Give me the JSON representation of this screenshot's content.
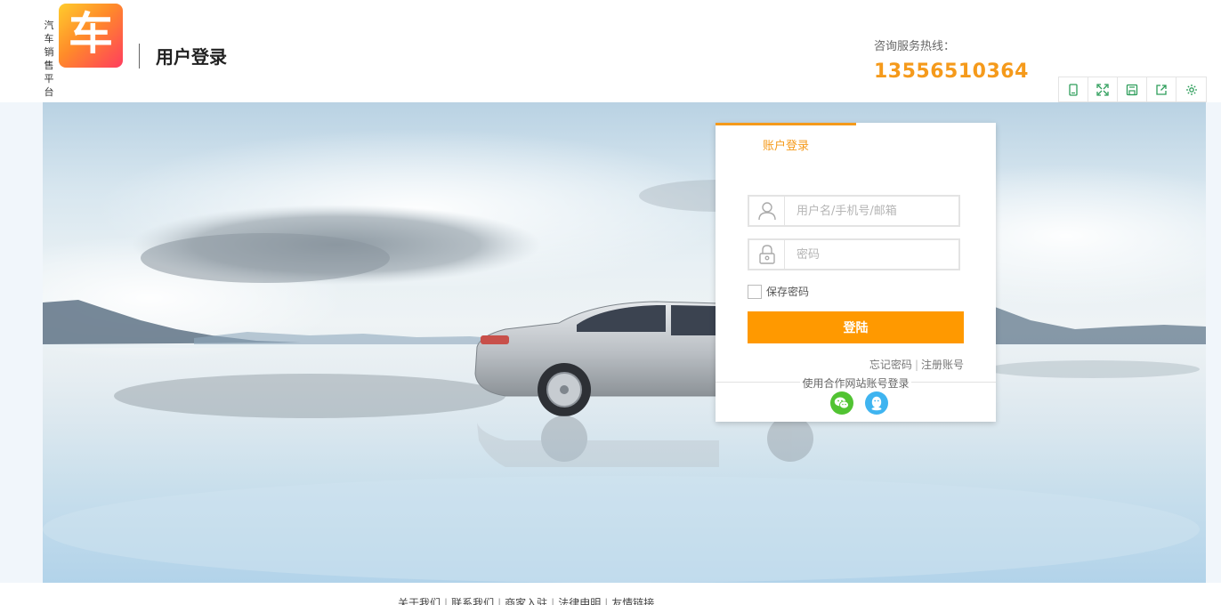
{
  "header": {
    "brand_vertical": "汽车销售平台",
    "logo_char": "车",
    "page_title": "用户登录",
    "hotline_label": "咨询服务热线：",
    "hotline_number": "13556510364",
    "accent_color": "#f59a1b",
    "toolbar_icons": [
      "mobile-icon",
      "expand-icon",
      "save-icon",
      "share-icon",
      "settings-icon"
    ]
  },
  "login": {
    "tab_label": "账户登录",
    "username_placeholder": "用户名/手机号/邮箱",
    "password_placeholder": "密码",
    "remember_label": "保存密码",
    "submit_label": "登陆",
    "forgot_label": "忘记密码",
    "register_label": "注册账号",
    "third_party_label": "使用合作网站账号登录",
    "third_party_icons": [
      "wechat-icon",
      "qq-icon"
    ],
    "button_color": "#ff9900"
  },
  "footer": {
    "links": [
      "关于我们",
      "联系我们",
      "商家入驻",
      "法律申明",
      "友情链接"
    ]
  }
}
